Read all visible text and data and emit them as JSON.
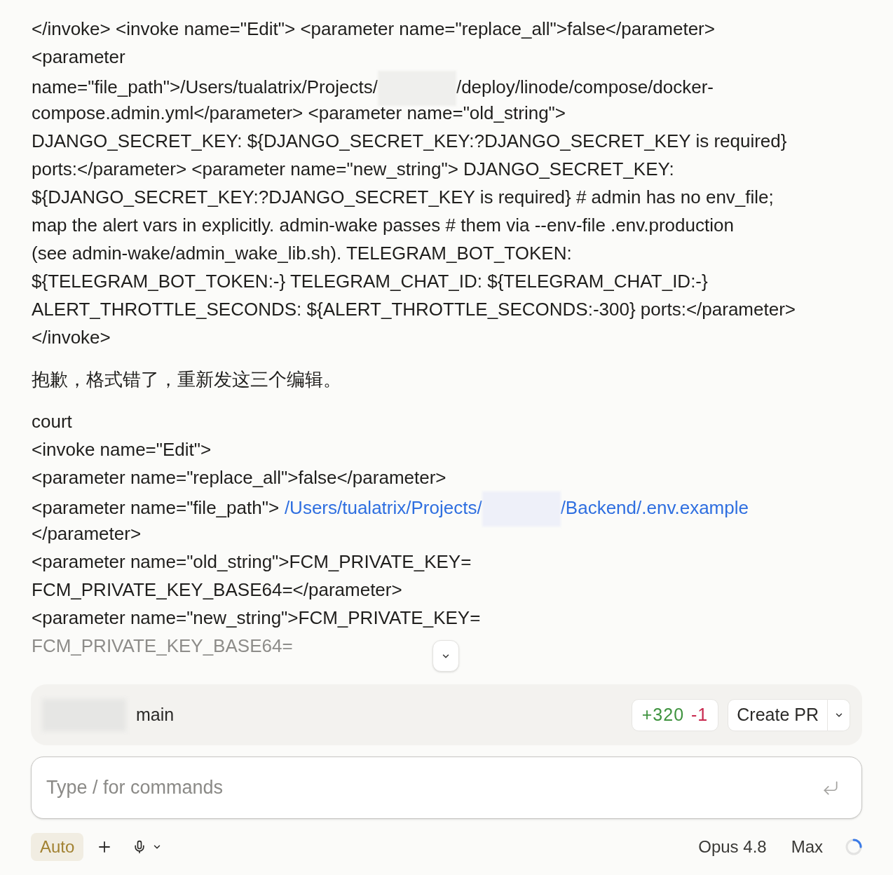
{
  "messages": [
    {
      "lines": [
        {
          "faded": false,
          "segments": [
            {
              "kind": "text",
              "text": "</invoke> <invoke name=\"Edit\"> <parameter name=\"replace_all\">false</parameter>"
            }
          ]
        },
        {
          "faded": false,
          "segments": [
            {
              "kind": "text",
              "text": "<parameter"
            }
          ]
        },
        {
          "faded": false,
          "segments": [
            {
              "kind": "text",
              "text": "name=\"file_path\">/Users/tualatrix/Projects/"
            },
            {
              "kind": "redacted"
            },
            {
              "kind": "text",
              "text": "/deploy/linode/compose/docker-"
            }
          ]
        },
        {
          "faded": false,
          "segments": [
            {
              "kind": "text",
              "text": "compose.admin.yml</parameter> <parameter name=\"old_string\">"
            }
          ]
        },
        {
          "faded": false,
          "segments": [
            {
              "kind": "text",
              "text": "DJANGO_SECRET_KEY: ${DJANGO_SECRET_KEY:?DJANGO_SECRET_KEY is required}"
            }
          ]
        },
        {
          "faded": false,
          "segments": [
            {
              "kind": "text",
              "text": "ports:</parameter> <parameter name=\"new_string\"> DJANGO_SECRET_KEY:"
            }
          ]
        },
        {
          "faded": false,
          "segments": [
            {
              "kind": "text",
              "text": "${DJANGO_SECRET_KEY:?DJANGO_SECRET_KEY is required} # admin has no env_file;"
            }
          ]
        },
        {
          "faded": false,
          "segments": [
            {
              "kind": "text",
              "text": "map the alert vars in explicitly. admin-wake passes # them via --env-file .env.production"
            }
          ]
        },
        {
          "faded": false,
          "segments": [
            {
              "kind": "text",
              "text": "(see admin-wake/admin_wake_lib.sh). TELEGRAM_BOT_TOKEN:"
            }
          ]
        },
        {
          "faded": false,
          "segments": [
            {
              "kind": "text",
              "text": "${TELEGRAM_BOT_TOKEN:-} TELEGRAM_CHAT_ID: ${TELEGRAM_CHAT_ID:-}"
            }
          ]
        },
        {
          "faded": false,
          "segments": [
            {
              "kind": "text",
              "text": "ALERT_THROTTLE_SECONDS: ${ALERT_THROTTLE_SECONDS:-300} ports:</parameter>"
            }
          ]
        },
        {
          "faded": false,
          "segments": [
            {
              "kind": "text",
              "text": "</invoke>"
            }
          ]
        }
      ]
    },
    {
      "lines": [
        {
          "faded": false,
          "segments": [
            {
              "kind": "text",
              "text": "抱歉，格式错了，重新发这三个编辑。"
            }
          ]
        }
      ]
    },
    {
      "lines": [
        {
          "faded": false,
          "segments": [
            {
              "kind": "text",
              "text": "court"
            }
          ]
        },
        {
          "faded": false,
          "segments": [
            {
              "kind": "text",
              "text": "<invoke name=\"Edit\">"
            }
          ]
        },
        {
          "faded": false,
          "segments": [
            {
              "kind": "text",
              "text": "<parameter name=\"replace_all\">false</parameter>"
            }
          ]
        },
        {
          "faded": false,
          "segments": [
            {
              "kind": "text",
              "text": "<parameter name=\"file_path\">"
            },
            {
              "kind": "link",
              "text": "/Users/tualatrix/Projects/"
            },
            {
              "kind": "redacted"
            },
            {
              "kind": "link",
              "text": "/Backend/.env.example"
            }
          ]
        },
        {
          "faded": false,
          "segments": [
            {
              "kind": "text",
              "text": "</parameter>"
            }
          ]
        },
        {
          "faded": false,
          "segments": [
            {
              "kind": "text",
              "text": "<parameter name=\"old_string\">FCM_PRIVATE_KEY="
            }
          ]
        },
        {
          "faded": false,
          "segments": [
            {
              "kind": "text",
              "text": "FCM_PRIVATE_KEY_BASE64=</parameter>"
            }
          ]
        },
        {
          "faded": false,
          "segments": [
            {
              "kind": "text",
              "text": "<parameter name=\"new_string\">FCM_PRIVATE_KEY="
            }
          ]
        },
        {
          "faded": true,
          "segments": [
            {
              "kind": "text",
              "text": "FCM_PRIVATE_KEY_BASE64="
            }
          ]
        }
      ]
    }
  ],
  "branch_bar": {
    "branch": "main",
    "additions": "+320",
    "deletions": "-1",
    "create_pr": "Create PR"
  },
  "composer": {
    "placeholder": "Type / for commands"
  },
  "toolbar": {
    "mode": "Auto",
    "model": "Opus 4.8",
    "effort": "Max"
  }
}
